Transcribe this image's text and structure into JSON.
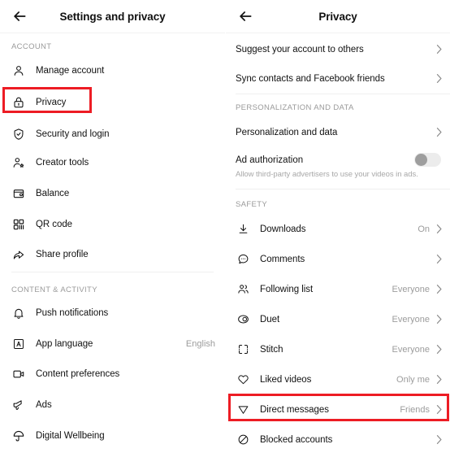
{
  "accent_red": "#ed1c24",
  "left_panel": {
    "header": {
      "back_icon": "arrow-left-icon",
      "title": "Settings and privacy"
    },
    "sections": [
      {
        "label": "ACCOUNT",
        "items": [
          {
            "icon": "person-icon",
            "label": "Manage account",
            "value": "",
            "chevron": false,
            "highlighted": false
          },
          {
            "icon": "lock-icon",
            "label": "Privacy",
            "value": "",
            "chevron": false,
            "highlighted": true
          },
          {
            "icon": "shield-check-icon",
            "label": "Security and login",
            "value": "",
            "chevron": false,
            "highlighted": false
          },
          {
            "icon": "person-star-icon",
            "label": "Creator tools",
            "value": "",
            "chevron": false,
            "highlighted": false
          },
          {
            "icon": "wallet-icon",
            "label": "Balance",
            "value": "",
            "chevron": false,
            "highlighted": false
          },
          {
            "icon": "qr-code-icon",
            "label": "QR code",
            "value": "",
            "chevron": false,
            "highlighted": false
          },
          {
            "icon": "share-arrow-icon",
            "label": "Share profile",
            "value": "",
            "chevron": false,
            "highlighted": false
          }
        ]
      },
      {
        "label": "CONTENT & ACTIVITY",
        "items": [
          {
            "icon": "bell-icon",
            "label": "Push notifications",
            "value": "",
            "chevron": false,
            "highlighted": false
          },
          {
            "icon": "language-a-icon",
            "label": "App language",
            "value": "English",
            "chevron": false,
            "highlighted": false
          },
          {
            "icon": "video-box-icon",
            "label": "Content preferences",
            "value": "",
            "chevron": false,
            "highlighted": false
          },
          {
            "icon": "megaphone-icon",
            "label": "Ads",
            "value": "",
            "chevron": false,
            "highlighted": false
          },
          {
            "icon": "umbrella-icon",
            "label": "Digital Wellbeing",
            "value": "",
            "chevron": false,
            "highlighted": false
          }
        ]
      }
    ]
  },
  "right_panel": {
    "header": {
      "back_icon": "arrow-left-icon",
      "title": "Privacy"
    },
    "top_items": [
      {
        "label": "Suggest your account to others",
        "value": "",
        "chevron": true
      },
      {
        "label": "Sync contacts and Facebook friends",
        "value": "",
        "chevron": true
      }
    ],
    "personalization": {
      "label": "PERSONALIZATION AND DATA",
      "items": [
        {
          "label": "Personalization and data",
          "value": "",
          "chevron": true
        }
      ]
    },
    "ad_authorization": {
      "title": "Ad authorization",
      "subtitle": "Allow third-party advertisers to use your videos in ads.",
      "toggle_state": "off"
    },
    "safety": {
      "label": "SAFETY",
      "items": [
        {
          "icon": "download-icon",
          "label": "Downloads",
          "value": "On",
          "chevron": true,
          "highlighted": false
        },
        {
          "icon": "comment-icon",
          "label": "Comments",
          "value": "",
          "chevron": true,
          "highlighted": false
        },
        {
          "icon": "people-icon",
          "label": "Following list",
          "value": "Everyone",
          "chevron": true,
          "highlighted": false
        },
        {
          "icon": "duet-icon",
          "label": "Duet",
          "value": "Everyone",
          "chevron": true,
          "highlighted": false
        },
        {
          "icon": "stitch-icon",
          "label": "Stitch",
          "value": "Everyone",
          "chevron": true,
          "highlighted": false
        },
        {
          "icon": "heart-icon",
          "label": "Liked videos",
          "value": "Only me",
          "chevron": true,
          "highlighted": false
        },
        {
          "icon": "paper-plane-icon",
          "label": "Direct messages",
          "value": "Friends",
          "chevron": true,
          "highlighted": true
        },
        {
          "icon": "block-icon",
          "label": "Blocked accounts",
          "value": "",
          "chevron": true,
          "highlighted": false
        }
      ]
    }
  }
}
